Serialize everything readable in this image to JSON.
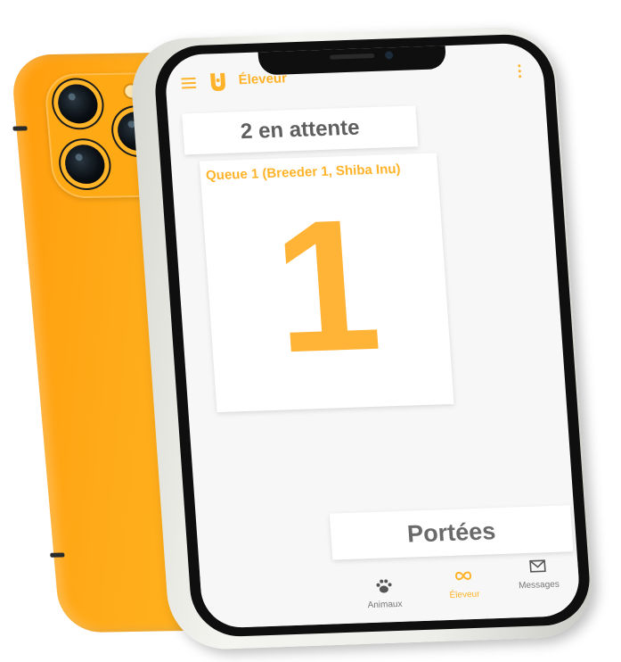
{
  "app": {
    "title": "Éleveur"
  },
  "queue": {
    "waiting_label": "2 en attente",
    "title": "Queue 1 (Breeder 1, Shiba Inu)",
    "current_number": "1"
  },
  "litters": {
    "label": "Portées"
  },
  "bottom_nav": {
    "items": [
      {
        "label": "Animaux",
        "icon": "paw-icon",
        "active": false
      },
      {
        "label": "Éleveur",
        "icon": "infinity-icon",
        "active": true
      },
      {
        "label": "Messages",
        "icon": "envelope-icon",
        "active": false
      }
    ]
  },
  "colors": {
    "accent": "#ffb32a",
    "phone_body": "#ffa915",
    "screen_bg": "#f7f7f7",
    "text_dark": "#5f5f5f"
  }
}
